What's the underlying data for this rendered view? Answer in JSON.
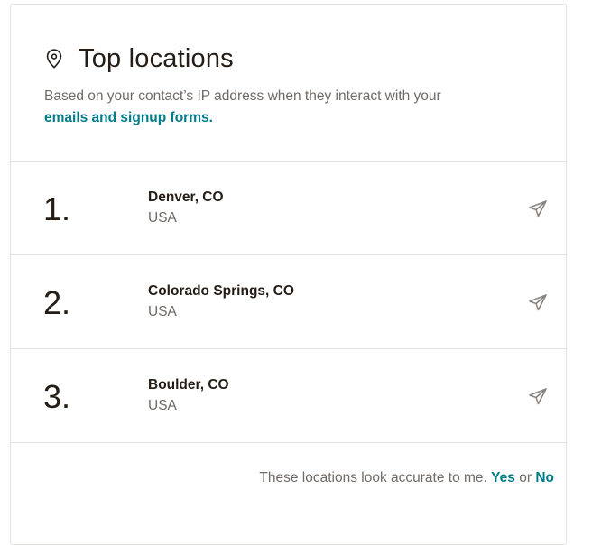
{
  "card": {
    "title": "Top locations",
    "title_icon": "map-pin-icon",
    "subtitle": "Based on your contact’s IP address when they interact with your",
    "subtitle_link": "emails and signup forms."
  },
  "locations": [
    {
      "rank": "1.",
      "city": "Denver, CO",
      "country": "USA",
      "action_icon": "send-icon"
    },
    {
      "rank": "2.",
      "city": "Colorado Springs, CO",
      "country": "USA",
      "action_icon": "send-icon"
    },
    {
      "rank": "3.",
      "city": "Boulder, CO",
      "country": "USA",
      "action_icon": "send-icon"
    }
  ],
  "footer": {
    "prompt": "These locations look accurate to me.",
    "yes_label": "Yes",
    "or_text": "or",
    "no_label": "No"
  },
  "colors": {
    "accent": "#007c89",
    "text_primary": "#241c15",
    "text_secondary": "#6f6a66",
    "border": "#e2e2e0"
  }
}
